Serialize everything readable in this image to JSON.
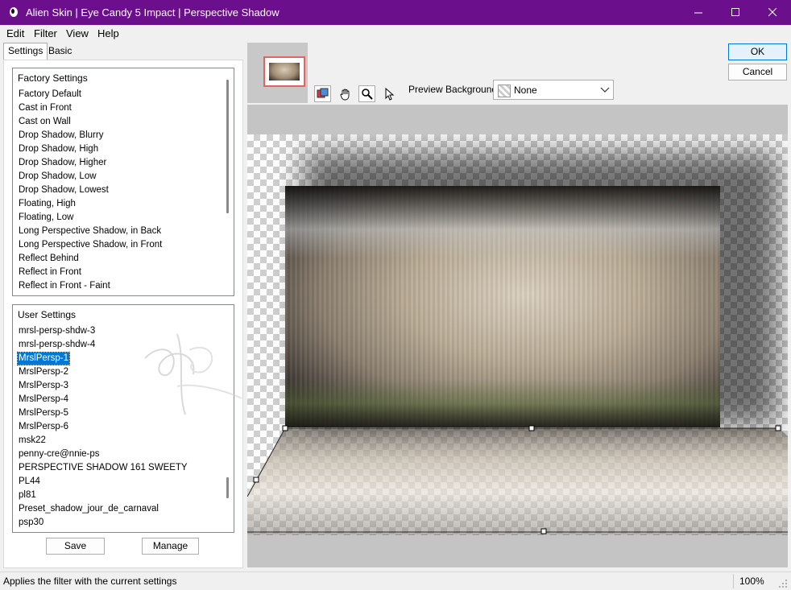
{
  "window": {
    "title": "Alien Skin | Eye Candy 5 Impact | Perspective Shadow",
    "accent_color": "#6c0f8c"
  },
  "menu": {
    "edit": "Edit",
    "filter": "Filter",
    "view": "View",
    "help": "Help"
  },
  "tabs": {
    "settings": "Settings",
    "basic": "Basic"
  },
  "factory": {
    "heading": "Factory Settings",
    "items": [
      "Factory Default",
      "Cast in Front",
      "Cast on Wall",
      "Drop Shadow, Blurry",
      "Drop Shadow, High",
      "Drop Shadow, Higher",
      "Drop Shadow, Low",
      "Drop Shadow, Lowest",
      "Floating, High",
      "Floating, Low",
      "Long Perspective Shadow, in Back",
      "Long Perspective Shadow, in Front",
      "Reflect Behind",
      "Reflect in Front",
      "Reflect in Front - Faint"
    ]
  },
  "user": {
    "heading": "User Settings",
    "items": [
      "mrsl-persp-shdw-3",
      "mrsl-persp-shdw-4",
      "MrslPersp-1",
      "MrslPersp-2",
      "MrslPersp-3",
      "MrslPersp-4",
      "MrslPersp-5",
      "MrslPersp-6",
      "msk22",
      "penny-cre@nnie-ps",
      "PERSPECTIVE SHADOW 161 SWEETY",
      "PL44",
      "pl81",
      "Preset_shadow_jour_de_carnaval",
      "psp30"
    ],
    "selected": "MrslPersp-1"
  },
  "buttons": {
    "save": "Save",
    "manage": "Manage",
    "ok": "OK",
    "cancel": "Cancel"
  },
  "preview": {
    "background_label": "Preview Background:",
    "background_value": "None"
  },
  "status": {
    "message": "Applies the filter with the current settings",
    "zoom": "100%"
  }
}
